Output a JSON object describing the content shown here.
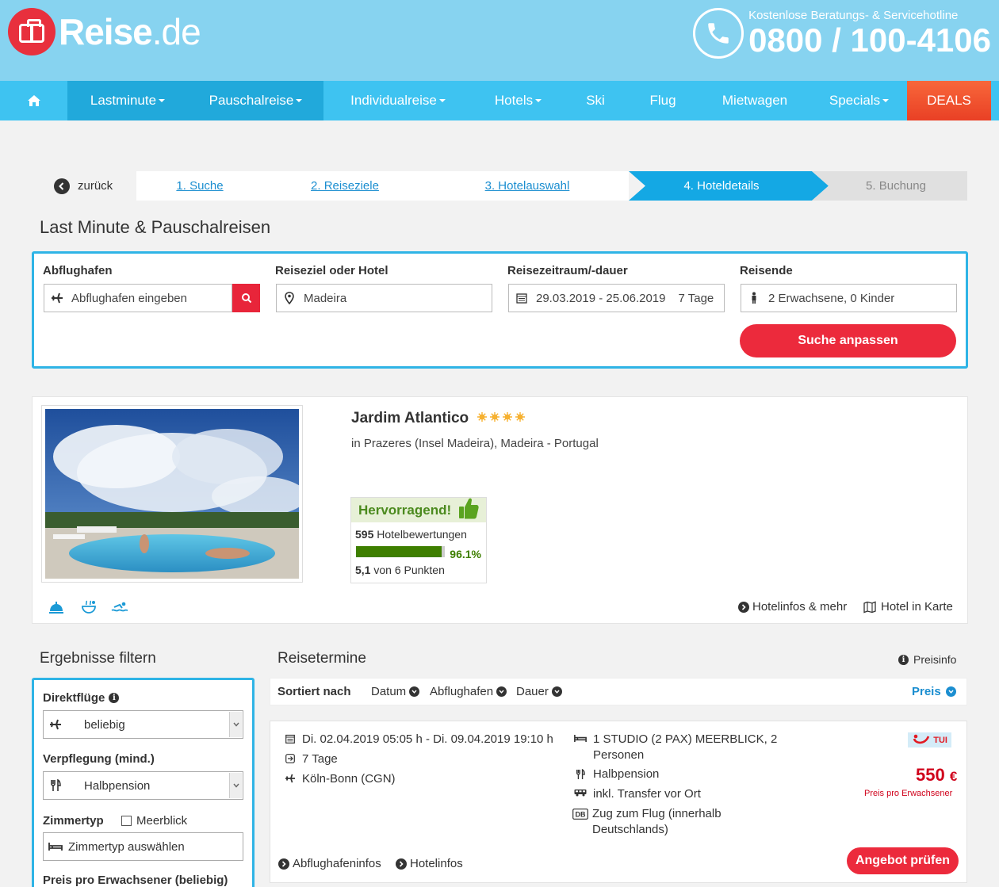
{
  "header": {
    "logo_text_bold": "Reise",
    "logo_text_light": ".de",
    "hotline_label": "Kostenlose Beratungs- & Servicehotline",
    "hotline_number": "0800 / 100-4106"
  },
  "nav": {
    "items": [
      {
        "label": "Lastminute",
        "dropdown": true
      },
      {
        "label": "Pauschalreise",
        "dropdown": true
      },
      {
        "label": "Individualreise",
        "dropdown": true
      },
      {
        "label": "Hotels",
        "dropdown": true
      },
      {
        "label": "Ski",
        "dropdown": false
      },
      {
        "label": "Flug",
        "dropdown": false
      },
      {
        "label": "Mietwagen",
        "dropdown": false
      },
      {
        "label": "Specials",
        "dropdown": true
      },
      {
        "label": "DEALS",
        "dropdown": false
      }
    ]
  },
  "steps": {
    "back_label": "zurück",
    "items": [
      {
        "label": "1. Suche",
        "state": "done"
      },
      {
        "label": "2. Reiseziele",
        "state": "done"
      },
      {
        "label": "3. Hotelauswahl",
        "state": "done"
      },
      {
        "label": "4. Hoteldetails",
        "state": "active"
      },
      {
        "label": "5. Buchung",
        "state": "pending"
      }
    ]
  },
  "page_title": "Last Minute & Pauschalreisen",
  "search": {
    "departure_label": "Abflughafen",
    "departure_placeholder": "Abflughafen eingeben",
    "destination_label": "Reiseziel oder Hotel",
    "destination_value": "Madeira",
    "period_label": "Reisezeitraum/-dauer",
    "period_value": "29.03.2019 - 25.06.2019",
    "duration_value": "7 Tage",
    "travelers_label": "Reisende",
    "travelers_value": "2 Erwachsene, 0 Kinder",
    "submit_label": "Suche anpassen"
  },
  "hotel": {
    "name": "Jardim Atlantico",
    "stars": 4,
    "location": "in Prazeres (Insel Madeira), Madeira - Portugal",
    "rating_label": "Hervorragend!",
    "review_count": "595",
    "review_label": "Hotelbewertungen",
    "recommend_percent": 96.1,
    "recommend_text": "96.1%",
    "score": "5,1",
    "score_suffix": "von 6 Punkten",
    "link_info": "Hotelinfos & mehr",
    "link_map": "Hotel in Karte"
  },
  "filter": {
    "title": "Ergebnisse filtern",
    "direct_label": "Direktflüge",
    "direct_value": "beliebig",
    "board_label": "Verpflegung (mind.)",
    "board_value": "Halbpension",
    "room_label": "Zimmertyp",
    "room_checkbox": "Meerblick",
    "room_placeholder": "Zimmertyp auswählen",
    "price_label": "Preis pro Erwachsener (beliebig)"
  },
  "results": {
    "title": "Reisetermine",
    "price_info": "Preisinfo",
    "sorted_by": "Sortiert nach",
    "sort_options": [
      "Datum",
      "Abflughafen",
      "Dauer"
    ],
    "sort_active": "Preis",
    "offer": {
      "dates": "Di. 02.04.2019 05:05 h - Di. 09.04.2019 19:10 h",
      "duration": "7 Tage",
      "airport": "Köln-Bonn (CGN)",
      "room_line1": "1 STUDIO (2 PAX) MEERBLICK, 2",
      "room_line2": "Personen",
      "board": "Halbpension",
      "transfer": "inkl. Transfer vor Ort",
      "train_line1": "Zug zum Flug (innerhalb",
      "train_line2": "Deutschlands)",
      "operator": "TUI",
      "price": "550",
      "currency": "€",
      "price_note": "Preis pro Erwachsener",
      "airport_info": "Abflughafeninfos",
      "hotel_info": "Hotelinfos",
      "cta": "Angebot prüfen"
    }
  },
  "colors": {
    "header_bg": "#87d3f0",
    "nav_bg": "#3ec3f1",
    "accent_red": "#ec2a3c",
    "step_active": "#14a8e4",
    "rating_green": "#3e7f00"
  }
}
